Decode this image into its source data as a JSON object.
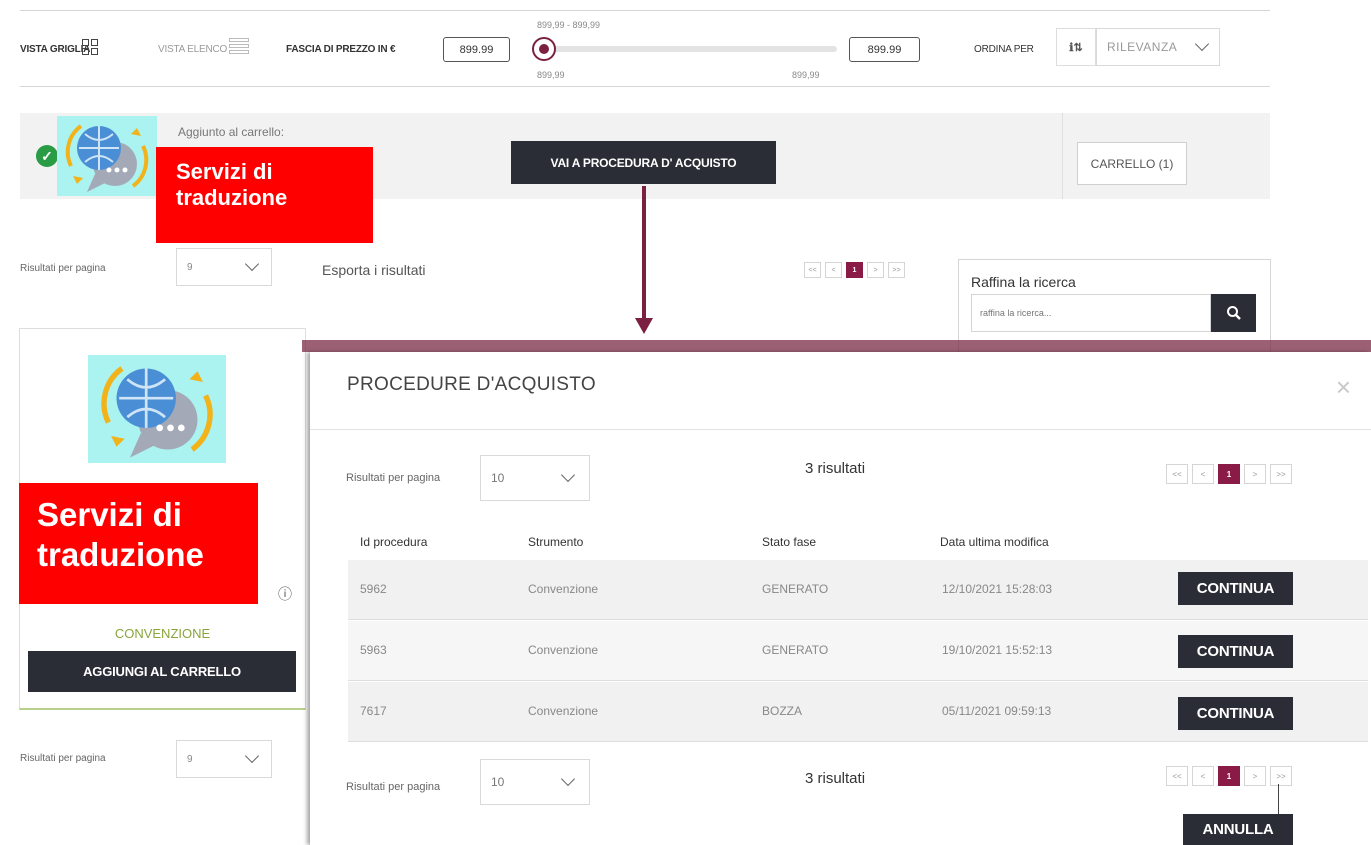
{
  "toolbar": {
    "grid_view_label": "VISTA GRIGLIA",
    "list_view_label": "VISTA ELENCO",
    "price_range_label": "FASCIA DI PREZZO IN €",
    "price_min_box": "899.99",
    "price_max_box": "899.99",
    "price_range_text": "899,99 - 899,99",
    "slider_min_label": "899,99",
    "slider_max_label": "899,99",
    "slider_position": 0,
    "sort_label": "ORDINA PER",
    "sort_icon_text": "ℹ⇅",
    "sort_selected": "RILEVANZA"
  },
  "notice": {
    "added_text": "Aggiunto al carrello:",
    "checkout_button": "VAI A PROCEDURA D' ACQUISTO",
    "cart_button": "CARRELLO (1)"
  },
  "service_label": "Servizi di traduzione",
  "results_bar": {
    "per_page_label": "Risultati per pagina",
    "per_page_value": "9",
    "export_link": "Esporta i risultati",
    "pager": [
      "<<",
      "<",
      "1",
      ">",
      ">>"
    ]
  },
  "refine": {
    "title": "Raffina la ricerca",
    "placeholder": "raffina la ricerca..."
  },
  "card": {
    "type_label": "CONVENZIONE",
    "add_to_cart_button": "AGGIUNGI AL CARRELLO",
    "info_icon": "ⓘ"
  },
  "bottom_bar": {
    "per_page_label": "Risultati per pagina",
    "per_page_value": "9"
  },
  "modal": {
    "title": "PROCEDURE D'ACQUISTO",
    "close": "×",
    "per_page_label": "Risultati per pagina",
    "per_page_value": "10",
    "results_count": "3 risultati",
    "pager": [
      "<<",
      "<",
      "1",
      ">",
      ">>"
    ],
    "columns": [
      "Id procedura",
      "Strumento",
      "Stato fase",
      "Data ultima modifica"
    ],
    "rows": [
      {
        "id": "5962",
        "tool": "Convenzione",
        "status": "GENERATO",
        "date": "12/10/2021 15:28:03",
        "action": "CONTINUA"
      },
      {
        "id": "5963",
        "tool": "Convenzione",
        "status": "GENERATO",
        "date": "19/10/2021 15:52:13",
        "action": "CONTINUA"
      },
      {
        "id": "7617",
        "tool": "Convenzione",
        "status": "BOZZA",
        "date": "05/11/2021 09:59:13",
        "action": "CONTINUA"
      }
    ],
    "cancel_button": "ANNULLA"
  },
  "colors": {
    "accent": "#7b2041",
    "dark_button": "#2b2d36",
    "success": "#2a9c45",
    "label_red": "#ff0000",
    "card_label_green": "#8aa43c"
  }
}
